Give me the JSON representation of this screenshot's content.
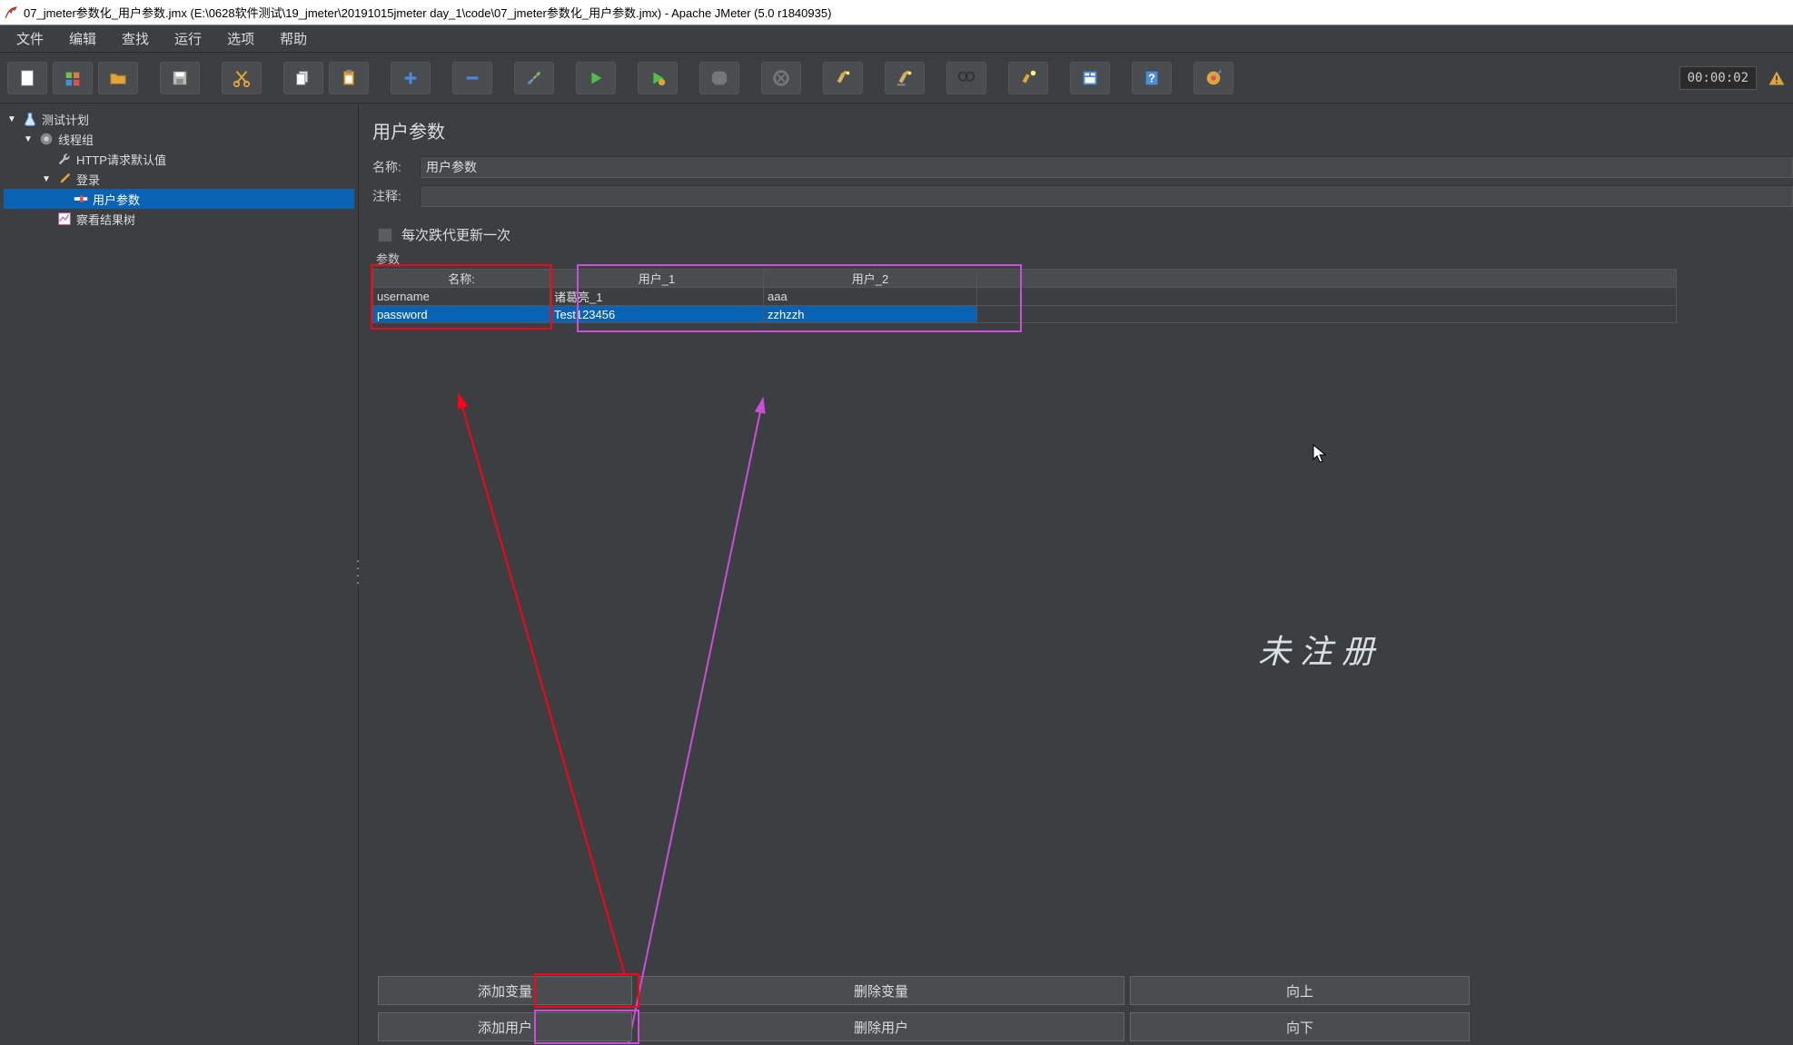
{
  "title": "07_jmeter参数化_用户参数.jmx (E:\\0628软件测试\\19_jmeter\\20191015jmeter day_1\\code\\07_jmeter参数化_用户参数.jmx) - Apache JMeter (5.0 r1840935)",
  "menus": [
    "文件",
    "编辑",
    "查找",
    "运行",
    "选项",
    "帮助"
  ],
  "timer": "00:00:02",
  "tree": {
    "testplan": "测试计划",
    "threadgroup": "线程组",
    "httpdefaults": "HTTP请求默认值",
    "login": "登录",
    "userparams": "用户参数",
    "viewresults": "察看结果树"
  },
  "panel": {
    "title": "用户参数",
    "name_label": "名称:",
    "name_value": "用户参数",
    "comment_label": "注释:",
    "comment_value": "",
    "iterate_checkbox": "每次跌代更新一次",
    "section_label": "参数",
    "table": {
      "headers": {
        "name": "名称:",
        "user1": "用户_1",
        "user2": "用户_2"
      },
      "rows": [
        {
          "name": "username",
          "user1": "诸葛亮_1",
          "user2": "aaa"
        },
        {
          "name": "password",
          "user1": "Test123456",
          "user2": "zzhzzh"
        }
      ]
    },
    "buttons": {
      "add_var": "添加变量",
      "del_var": "删除变量",
      "move_up": "向上",
      "add_user": "添加用户",
      "del_user": "删除用户",
      "move_down": "向下"
    }
  },
  "watermark": "未注册"
}
